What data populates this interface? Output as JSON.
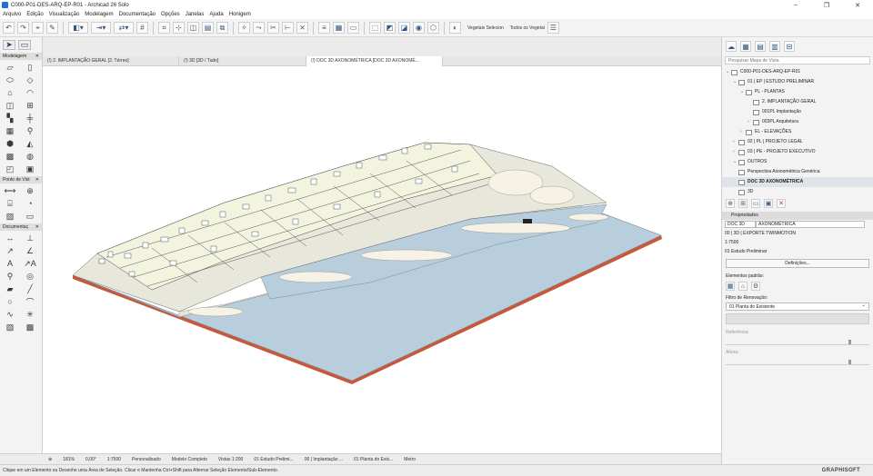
{
  "window": {
    "title": "C000-P01-DES-ARQ-EP-R01 - Archicad 26 Solo"
  },
  "menu": [
    "Arquivo",
    "Edição",
    "Visualização",
    "Modelagem",
    "Documentação",
    "Opções",
    "Janelas",
    "Ajuda",
    "Honigem"
  ],
  "toolbar": {
    "layer_a": "Vegetais Selecion",
    "layer_b": "Todos os Vegetai"
  },
  "toolbox": {
    "select_label": "Selecionar",
    "modelagem": "Modelagem",
    "ponto_de_vista": "Ponto de Vist",
    "documentacao": "Documentaç"
  },
  "tabs": [
    {
      "label": "(!) 2. IMPLANTAÇÃO GERAL [2. Térreo]"
    },
    {
      "label": "(!) 3D [3D / Tudo]"
    },
    {
      "label": "(!) DOC 3D AXONOMÉTRICA [DOC 3D AXONOMÉ..."
    }
  ],
  "navigator": {
    "search_placeholder": "Pesquisar Mapa de Vista",
    "tree": [
      {
        "label": "C000-P01-DES-ARQ-EP-R01",
        "indent": 0,
        "arrow": "⌄"
      },
      {
        "label": "01 | EP | ESTUDO PRELIMINAR",
        "indent": 1,
        "arrow": "⌄"
      },
      {
        "label": "PL - PLANTAS",
        "indent": 2,
        "arrow": "⌄"
      },
      {
        "label": "2. IMPLANTAÇÃO GERAL",
        "indent": 3,
        "arrow": ""
      },
      {
        "label": "001PL Implantação",
        "indent": 3,
        "arrow": ""
      },
      {
        "label": "003PL Arquitetura",
        "indent": 3,
        "arrow": "›"
      },
      {
        "label": "EL - ELEVAÇÕES",
        "indent": 2,
        "arrow": "›"
      },
      {
        "label": "02 | PL | PROJETO LEGAL",
        "indent": 1,
        "arrow": "›"
      },
      {
        "label": "03 | PE - PROJETO EXECUTIVO",
        "indent": 1,
        "arrow": "›"
      },
      {
        "label": "OUTROS",
        "indent": 1,
        "arrow": "⌄"
      },
      {
        "label": "Perspectiva Axonométrica Genérica",
        "indent": 1,
        "arrow": ""
      },
      {
        "label": "DOC 3D AXONOMÉTRICA",
        "indent": 1,
        "arrow": "",
        "selected": true
      },
      {
        "label": "3D",
        "indent": 1,
        "arrow": ""
      }
    ]
  },
  "properties": {
    "header": "Propriedades",
    "id": "DOC 3D",
    "name": "AXONOMÉTRICA",
    "set": "00 | 3D | EXPORTE TWINMOTION",
    "scale": "1:7500",
    "phase": "01 Estudo Preliminar",
    "definitions_button": "Definições...",
    "default_elements": "Elementos padrão:",
    "renovation_filter_label": "Filtro de Renovação:",
    "renovation_filter_value": "01 Planta do Existente",
    "referencia": "Referência:",
    "altura": "Altura:"
  },
  "bottombar": {
    "zoom": "181%",
    "angle": "0,00°",
    "scale": "1:7500",
    "pen": "Personalizado",
    "model": "Modelo Completo",
    "views": "Vistas 1:200",
    "phase": "01 Estudo Prelimi...",
    "layer": "00 | Implantação ...",
    "renovation": "01 Planta do Exis...",
    "unit": "Metro"
  },
  "status": {
    "hint": "Clique em um Elemento ou Desenhe uma Área de Seleção. Clicar e Mantenha Ctrl+Shift para Alternar Seleção Elemento/Sub-Elemento.",
    "brand": "GRAPHISOFT"
  },
  "colors": {
    "water": "#b9cedc",
    "terrain": "#e6e4da",
    "land": "#f3f4df",
    "edge": "#c8583a"
  }
}
